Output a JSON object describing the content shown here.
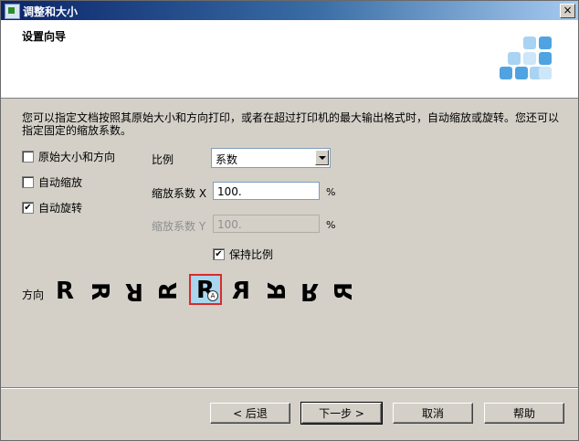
{
  "window": {
    "title": "调整和大小",
    "close_label": "×"
  },
  "header": {
    "title": "设置向导"
  },
  "description": "您可以指定文档按照其原始大小和方向打印，或者在超过打印机的最大输出格式时，自动缩放或旋转。您还可以指定固定的缩放系数。",
  "options": [
    {
      "label": "原始大小和方向",
      "checked": false
    },
    {
      "label": "自动缩放",
      "checked": false
    },
    {
      "label": "自动旋转",
      "checked": true
    }
  ],
  "scale": {
    "label": "比例",
    "selected": "系数",
    "factor_x_label": "缩放系数 X",
    "factor_x_value": "100.",
    "factor_y_label": "缩放系数 Y",
    "factor_y_value": "100.",
    "unit": "%",
    "keep_ratio_label": "保持比例",
    "keep_ratio_checked": true
  },
  "orientation": {
    "label": "方向",
    "selected_index": 4,
    "glyphs": [
      "R",
      "R",
      "R",
      "R",
      "R",
      "R",
      "R",
      "R",
      "R"
    ]
  },
  "buttons": {
    "back": "< 后退",
    "next": "下一步 >",
    "cancel": "取消",
    "help": "帮助"
  },
  "colors": {
    "title_start": "#0a246a",
    "title_end": "#a6caf0",
    "logo": "#4fa3e0",
    "selection_border": "#d92b2b"
  }
}
